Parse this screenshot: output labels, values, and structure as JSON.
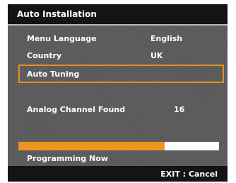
{
  "header": {
    "title": "Auto Installation"
  },
  "menu": {
    "language_label": "Menu Language",
    "language_value": "English",
    "country_label": "Country",
    "country_value": "UK",
    "auto_tuning_label": "Auto Tuning",
    "channels_label": "Analog Channel Found",
    "channels_value": "16"
  },
  "progress": {
    "fraction": 0.73,
    "label": "Programming Now",
    "fill_color": "#f0931f"
  },
  "footer": {
    "exit_label": "EXIT : Cancel"
  },
  "colors": {
    "accent": "#e88f1c",
    "panel": "#5b5b5b",
    "bar": "#141414"
  }
}
